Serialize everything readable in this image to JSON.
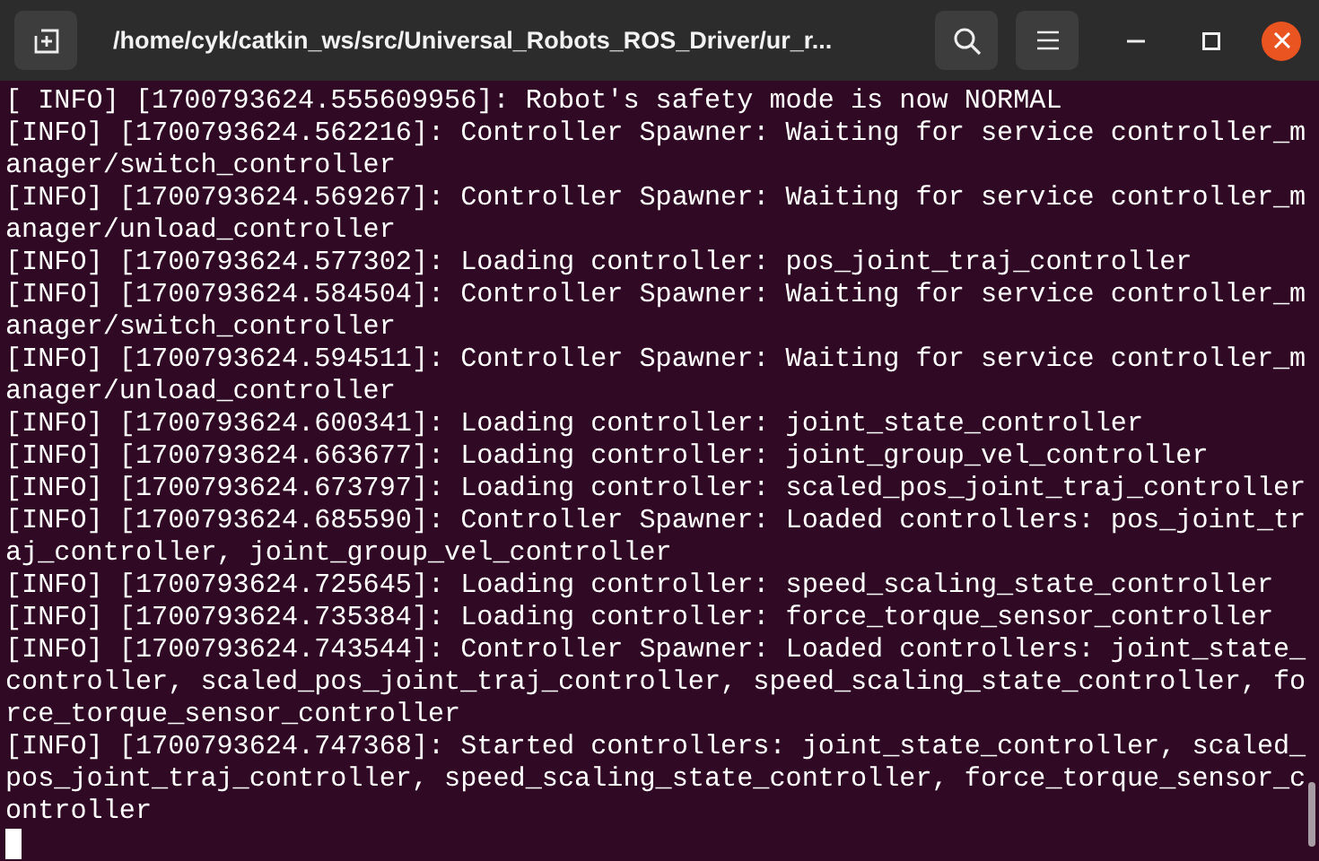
{
  "window": {
    "title": "/home/cyk/catkin_ws/src/Universal_Robots_ROS_Driver/ur_r..."
  },
  "terminal": {
    "lines": [
      "[ INFO] [1700793624.555609956]: Robot's safety mode is now NORMAL",
      "[INFO] [1700793624.562216]: Controller Spawner: Waiting for service controller_manager/switch_controller",
      "[INFO] [1700793624.569267]: Controller Spawner: Waiting for service controller_manager/unload_controller",
      "[INFO] [1700793624.577302]: Loading controller: pos_joint_traj_controller",
      "[INFO] [1700793624.584504]: Controller Spawner: Waiting for service controller_manager/switch_controller",
      "[INFO] [1700793624.594511]: Controller Spawner: Waiting for service controller_manager/unload_controller",
      "[INFO] [1700793624.600341]: Loading controller: joint_state_controller",
      "[INFO] [1700793624.663677]: Loading controller: joint_group_vel_controller",
      "[INFO] [1700793624.673797]: Loading controller: scaled_pos_joint_traj_controller",
      "[INFO] [1700793624.685590]: Controller Spawner: Loaded controllers: pos_joint_traj_controller, joint_group_vel_controller",
      "[INFO] [1700793624.725645]: Loading controller: speed_scaling_state_controller",
      "[INFO] [1700793624.735384]: Loading controller: force_torque_sensor_controller",
      "[INFO] [1700793624.743544]: Controller Spawner: Loaded controllers: joint_state_controller, scaled_pos_joint_traj_controller, speed_scaling_state_controller, force_torque_sensor_controller",
      "[INFO] [1700793624.747368]: Started controllers: joint_state_controller, scaled_pos_joint_traj_controller, speed_scaling_state_controller, force_torque_sensor_controller"
    ]
  }
}
